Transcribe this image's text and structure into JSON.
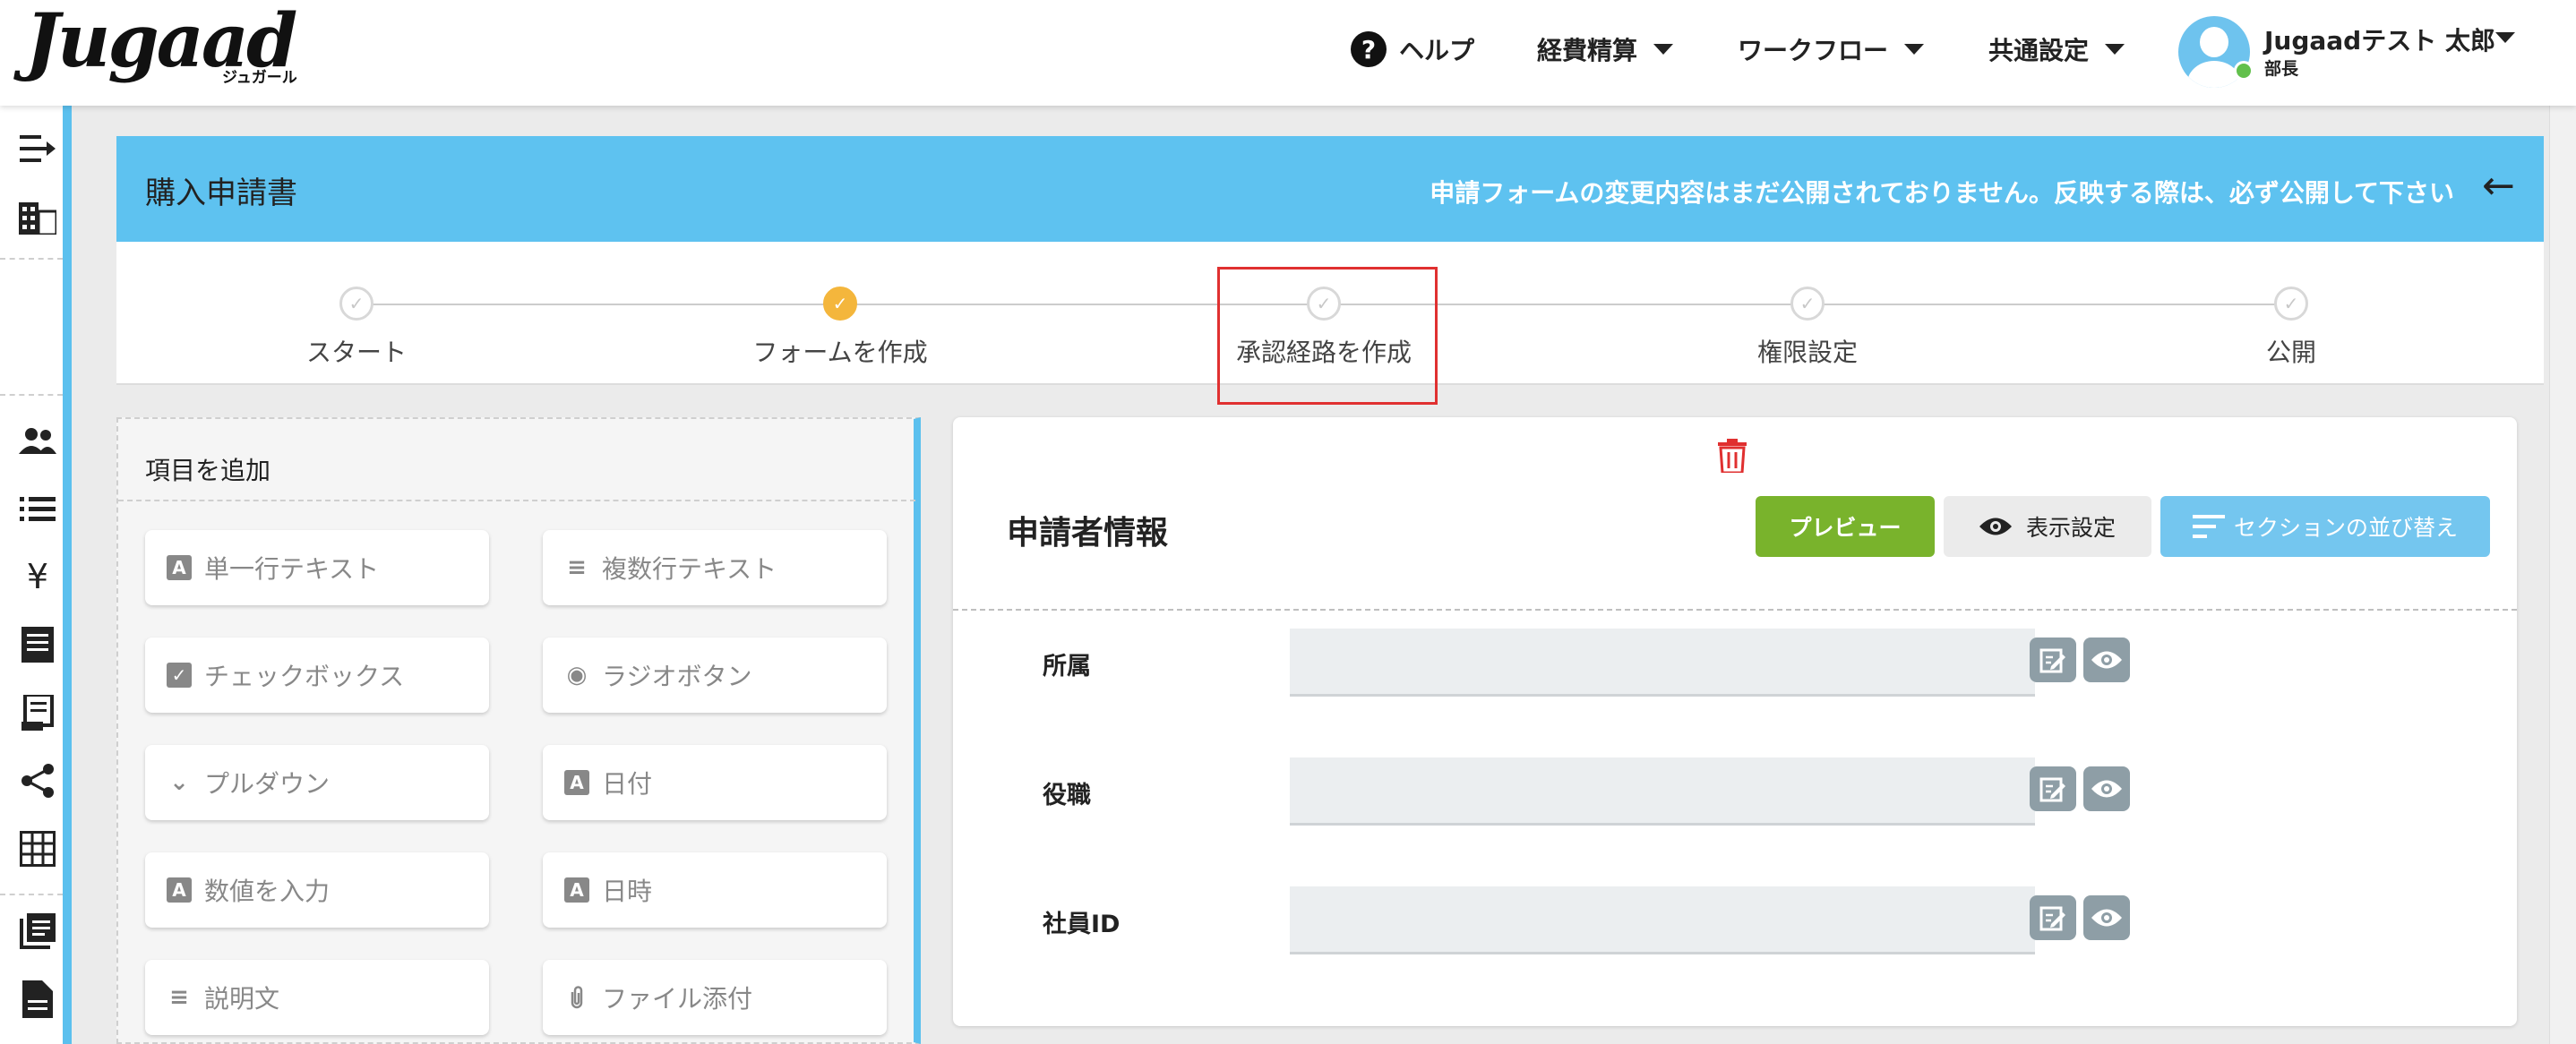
{
  "header": {
    "logo_text": "Jugaad",
    "logo_sub": "ジュガール",
    "help_label": "ヘルプ",
    "nav": [
      "経費精算",
      "ワークフロー",
      "共通設定"
    ],
    "user_name": "Jugaadテスト 太郎",
    "user_role": "部長"
  },
  "sidebar": {
    "icons": [
      "menu-arrow-icon",
      "building-icon",
      "people-icon",
      "list-icon",
      "yen-icon",
      "receipt-icon",
      "invoice-icon",
      "share-icon",
      "grid-icon",
      "book-icon",
      "document-icon"
    ]
  },
  "card": {
    "title": "購入申請書",
    "notice": "申請フォームの変更内容はまだ公開されておりません。反映する際は、必ず公開して下さい"
  },
  "steps": [
    {
      "label": "スタート",
      "active": false
    },
    {
      "label": "フォームを作成",
      "active": true
    },
    {
      "label": "承認経路を作成",
      "active": false
    },
    {
      "label": "権限設定",
      "active": false
    },
    {
      "label": "公開",
      "active": false
    }
  ],
  "left_panel": {
    "title": "項目を追加",
    "items": [
      {
        "label": "単一行テキスト",
        "icon": "A"
      },
      {
        "label": "複数行テキスト",
        "icon": "≡"
      },
      {
        "label": "チェックボックス",
        "icon": "✓"
      },
      {
        "label": "ラジオボタン",
        "icon": "◉"
      },
      {
        "label": "プルダウン",
        "icon": "⌄"
      },
      {
        "label": "日付",
        "icon": "A"
      },
      {
        "label": "数値を入力",
        "icon": "A"
      },
      {
        "label": "日時",
        "icon": "A"
      },
      {
        "label": "説明文",
        "icon": "≡"
      },
      {
        "label": "ファイル添付",
        "icon": "📎"
      }
    ]
  },
  "right_panel": {
    "section_title": "申請者情報",
    "preview_label": "プレビュー",
    "display_label": "表示設定",
    "sort_label": "セクションの並び替え",
    "fields": [
      "所属",
      "役職",
      "社員ID"
    ]
  },
  "colors": {
    "accent": "#5ec2f0",
    "preview": "#79b32c",
    "active_step": "#f4b63c",
    "highlight": "#e03030"
  }
}
